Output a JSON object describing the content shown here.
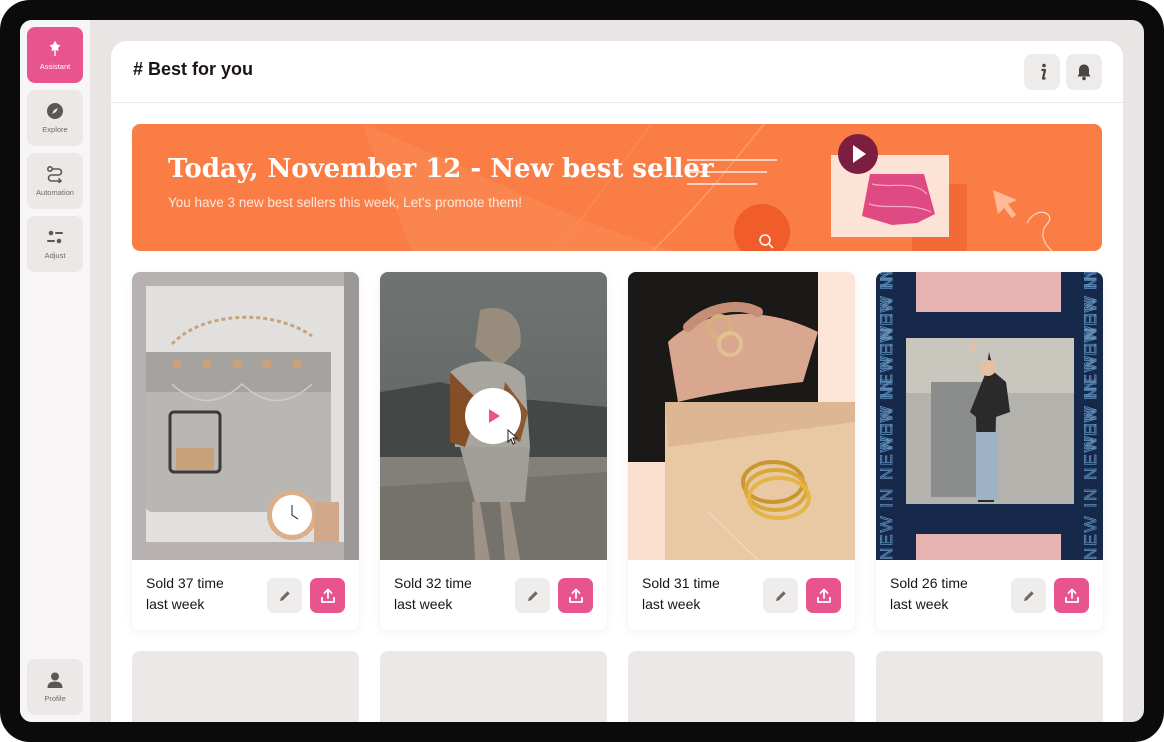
{
  "sidebar": {
    "items": [
      {
        "label": "Assistant",
        "icon": "pin-icon",
        "active": true
      },
      {
        "label": "Explore",
        "icon": "compass-icon",
        "active": false
      },
      {
        "label": "Automation",
        "icon": "route-icon",
        "active": false
      },
      {
        "label": "Adjust",
        "icon": "sliders-icon",
        "active": false
      }
    ],
    "profile": {
      "label": "Profile",
      "icon": "user-icon"
    }
  },
  "header": {
    "title": "# Best for you",
    "info_icon": "info-icon",
    "bell_icon": "bell-icon"
  },
  "banner": {
    "title": "Today, November 12 - New best seller",
    "subtitle": "You have 3 new best sellers this week, Let's promote them!"
  },
  "cards": [
    {
      "line1": "Sold 37 time",
      "line2": "last week",
      "image": "handbag-and-watch-photo"
    },
    {
      "line1": "Sold 32 time",
      "line2": "last week",
      "image": "woman-on-beach-video",
      "video": true
    },
    {
      "line1": "Sold 31 time",
      "line2": "last week",
      "image": "rings-photo"
    },
    {
      "line1": "Sold 26 time",
      "line2": "last week",
      "image": "new-in-poster-photo",
      "poster_text": "NEW IN"
    }
  ],
  "colors": {
    "accent_pink": "#e8548d",
    "banner_orange": "#fa7d45",
    "dark_navy": "#16294a",
    "text_dark": "#1b1416"
  }
}
